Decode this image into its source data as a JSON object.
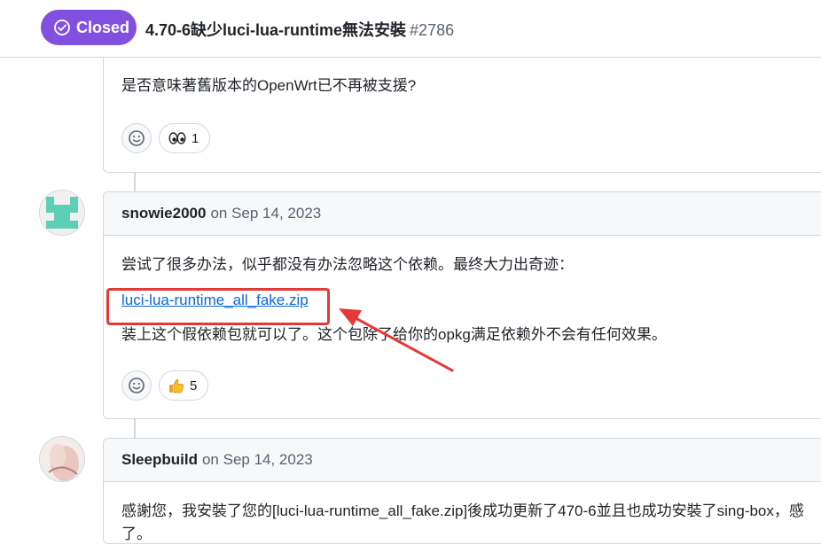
{
  "header": {
    "state_label": "Closed",
    "title": "4.70-6缺少luci-lua-runtime無法安裝",
    "number": "#2786"
  },
  "comments": [
    {
      "body": "是否意味著舊版本的OpenWrt已不再被支援?",
      "reactions": [
        {
          "emoji": "👀",
          "count": "1",
          "icon": "eyes-icon"
        }
      ]
    },
    {
      "author": "snowie2000",
      "timestamp": "on Sep 14, 2023",
      "line1": "尝试了很多办法，似乎都没有办法忽略这个依赖。最终大力出奇迹：",
      "link": "luci-lua-runtime_all_fake.zip",
      "line2": "装上这个假依赖包就可以了。这个包除了给你的opkg满足依赖外不会有任何效果。",
      "reactions": [
        {
          "emoji": "👍",
          "count": "5",
          "icon": "thumbs-up-icon"
        }
      ]
    },
    {
      "author": "Sleepbuild",
      "timestamp": "on Sep 14, 2023",
      "line1": "感謝您，我安裝了您的[luci-lua-runtime_all_fake.zip]後成功更新了470-6並且也成功安裝了sing-box，感",
      "line2": "了。"
    }
  ],
  "colors": {
    "closed_purple": "#8250df",
    "link_blue": "#0969da",
    "annotation_red": "#e53935"
  }
}
